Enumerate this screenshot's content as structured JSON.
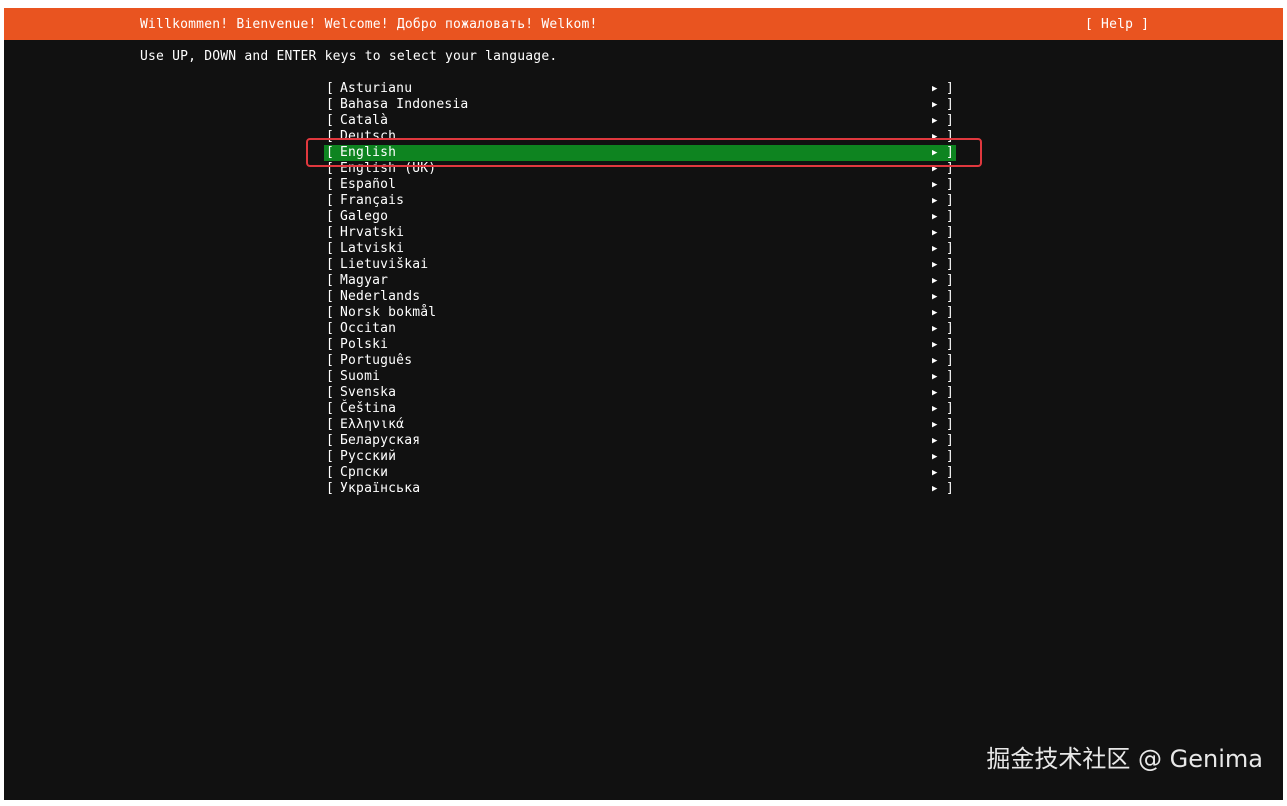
{
  "header": {
    "title": "Willkommen! Bienvenue! Welcome! Добро пожаловать! Welkom!",
    "help_label": "[ Help ]"
  },
  "instruction": "Use UP, DOWN and ENTER keys to select your language.",
  "languages": [
    "Asturianu",
    "Bahasa Indonesia",
    "Català",
    "Deutsch",
    "English",
    "English (UK)",
    "Español",
    "Français",
    "Galego",
    "Hrvatski",
    "Latviski",
    "Lietuviškai",
    "Magyar",
    "Nederlands",
    "Norsk bokmål",
    "Occitan",
    "Polski",
    "Português",
    "Suomi",
    "Svenska",
    "Čeština",
    "Ελληνικά",
    "Беларуская",
    "Русский",
    "Српски",
    "Українська"
  ],
  "selected_language": "English",
  "item_left_bracket": "[",
  "item_right_bracket": "]",
  "item_arrow": "▶",
  "watermark": "掘金技术社区 @ Genima",
  "colors": {
    "titlebar": "#e95420",
    "background": "#111111",
    "selected_row": "#0e8420",
    "annotation_box": "#e0383e"
  }
}
